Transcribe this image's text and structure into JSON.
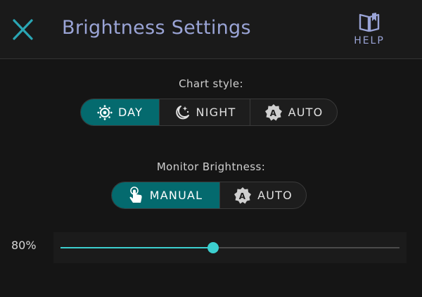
{
  "header": {
    "title": "Brightness Settings",
    "help_label": "HELP"
  },
  "chart_style": {
    "label": "Chart style:",
    "options": [
      {
        "label": "DAY",
        "icon": "sun-icon",
        "selected": true
      },
      {
        "label": "NIGHT",
        "icon": "moon-stars-icon",
        "selected": false
      },
      {
        "label": "AUTO",
        "icon": "auto-badge-icon",
        "selected": false
      }
    ]
  },
  "monitor_brightness": {
    "label": "Monitor Brightness:",
    "options": [
      {
        "label": "MANUAL",
        "icon": "hand-pointer-icon",
        "selected": true
      },
      {
        "label": "AUTO",
        "icon": "auto-badge-icon",
        "selected": false
      }
    ]
  },
  "slider": {
    "value_label": "80%",
    "value": 0.45
  },
  "colors": {
    "accent": "#046a6e",
    "slider": "#3ccfcf",
    "title": "#9aa4d6",
    "close": "#2aa6b4"
  }
}
